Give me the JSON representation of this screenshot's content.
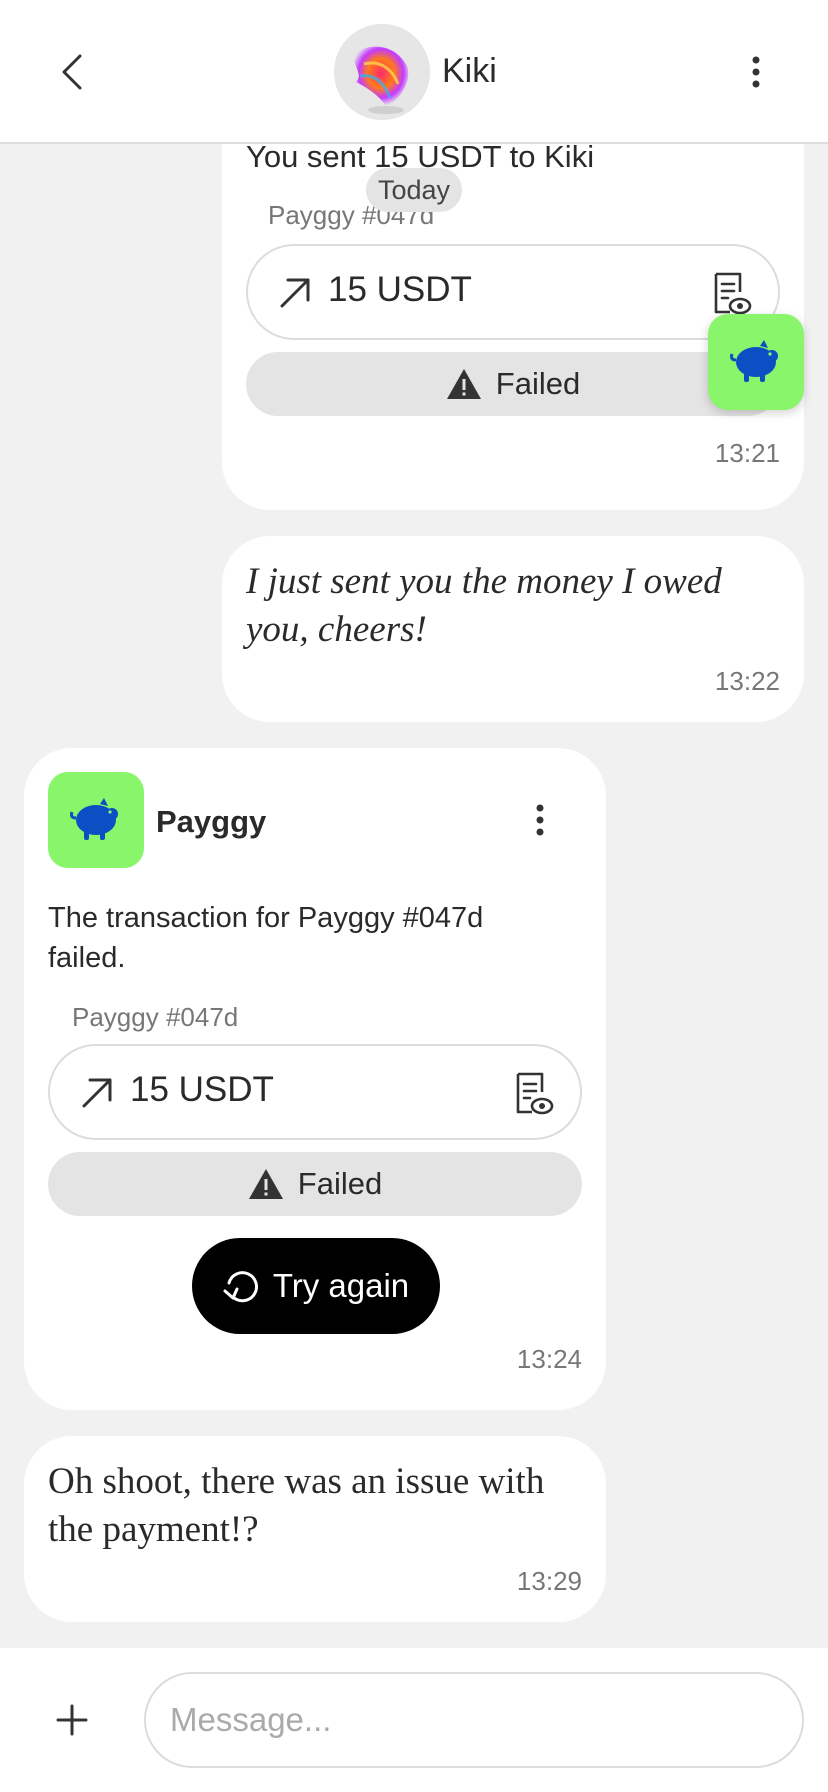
{
  "header": {
    "contact_name": "Kiki"
  },
  "date_divider": "Today",
  "messages": [
    {
      "type": "sent_payment",
      "text": "You sent 15 USDT to Kiki",
      "tx_id": "Payggy #047d",
      "amount": "15 USDT",
      "status": "Failed",
      "time": "13:21"
    },
    {
      "type": "sent_text",
      "text": "I just sent you the money I owed you, cheers!",
      "time": "13:22"
    },
    {
      "type": "bot_payment",
      "app_name": "Payggy",
      "text": "The transaction for Payggy #047d failed.",
      "tx_id": "Payggy #047d",
      "amount": "15 USDT",
      "status": "Failed",
      "action_label": "Try again",
      "time": "13:24"
    },
    {
      "type": "received_text",
      "text": "Oh shoot, there was an issue with the payment!?",
      "time": "13:29"
    }
  ],
  "composer": {
    "placeholder": "Message..."
  },
  "colors": {
    "accent_green": "#88f56a",
    "piggy_blue": "#0b4fc4",
    "background": "#f1f1f1"
  },
  "icons": {
    "back": "chevron-left-icon",
    "more": "more-vertical-icon",
    "app": "piggy-bank-icon",
    "send_arrow": "arrow-up-right-icon",
    "receipt": "receipt-view-icon",
    "warning": "warning-triangle-icon",
    "retry": "retry-icon",
    "plus": "plus-icon"
  }
}
